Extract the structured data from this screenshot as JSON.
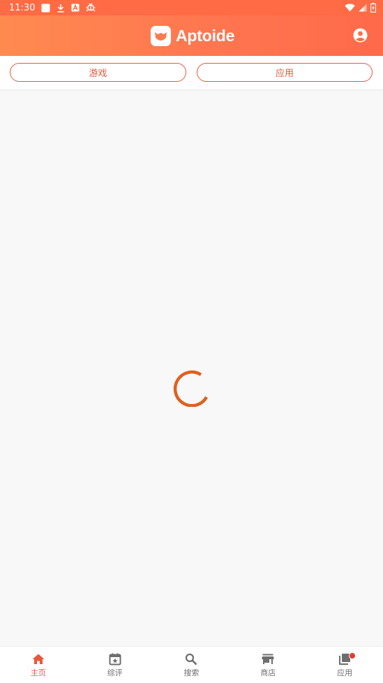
{
  "status_bar": {
    "time": "11:30",
    "left_icons": [
      "notification-square-icon",
      "download-icon",
      "font-a-icon",
      "bug-icon"
    ],
    "right_icons": [
      "wifi-icon",
      "cellular-signal-icon",
      "battery-icon"
    ]
  },
  "app_bar": {
    "brand_name": "Aptoide",
    "icons": [
      "aptoide-logo-icon",
      "account-icon"
    ]
  },
  "tabs": [
    {
      "label": "游戏"
    },
    {
      "label": "应用"
    }
  ],
  "content": {
    "state": "loading",
    "icon": "loading-spinner-icon"
  },
  "bottom_nav": [
    {
      "label": "主页",
      "icon": "home-icon",
      "active": true
    },
    {
      "label": "综评",
      "icon": "calendar-star-icon",
      "active": false
    },
    {
      "label": "搜索",
      "icon": "search-icon",
      "active": false
    },
    {
      "label": "商店",
      "icon": "store-icon",
      "active": false
    },
    {
      "label": "应用",
      "icon": "apps-library-icon",
      "active": false,
      "badge": true
    }
  ],
  "colors": {
    "accent": "#e8583a",
    "header_gradient_start": "#ff8a50",
    "header_gradient_end": "#ff6a4a",
    "spinner": "#e0601f",
    "background": "#f8f8f8",
    "badge": "#e83b2e"
  }
}
